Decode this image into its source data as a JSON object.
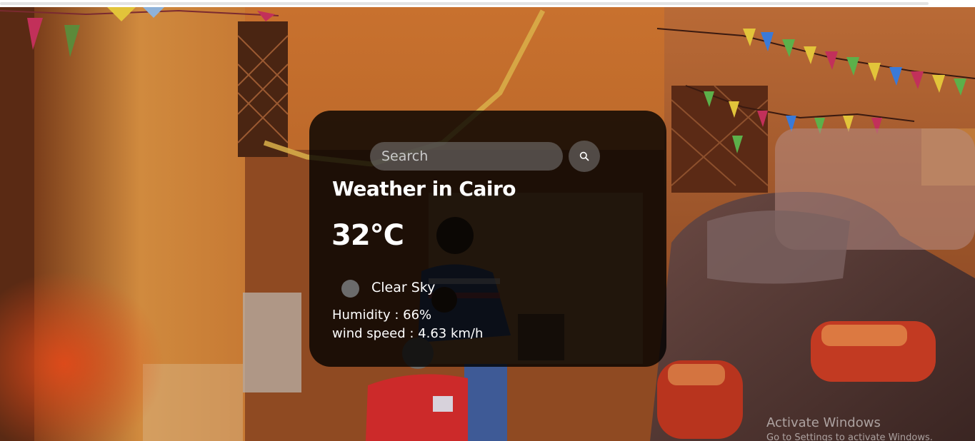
{
  "search": {
    "placeholder": "Search",
    "value": ""
  },
  "weather": {
    "title": "Weather in Cairo",
    "temperature": "32°C",
    "icon": "clear-sky-icon",
    "description": "Clear Sky",
    "humidity": "Humidity : 66%",
    "wind": "wind speed : 4.63 km/h"
  },
  "watermark": {
    "title": "Activate Windows",
    "subtitle": "Go to Settings to activate Windows."
  },
  "colors": {
    "card_background": "#000000cc",
    "text": "#ffffff",
    "control_background": "#7c7c7c"
  }
}
